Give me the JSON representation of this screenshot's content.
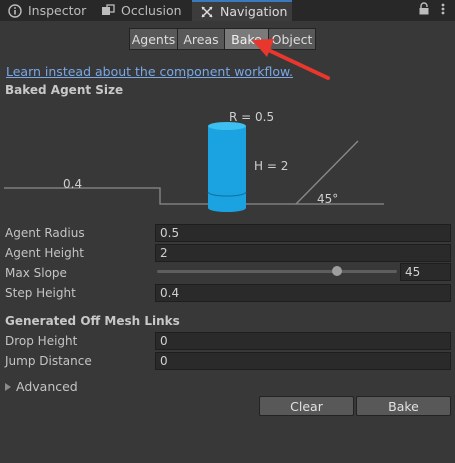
{
  "tabs": [
    {
      "label": "Inspector",
      "icon": "info-icon"
    },
    {
      "label": "Occlusion",
      "icon": "occlusion-icon"
    },
    {
      "label": "Navigation",
      "icon": "navigation-icon",
      "active": true
    }
  ],
  "window_controls": {
    "lock": "lock-icon",
    "menu": "kebab-menu-icon"
  },
  "segments": [
    "Agents",
    "Areas",
    "Bake",
    "Object"
  ],
  "selected_segment": "Bake",
  "link_text": "Learn instead about the component workflow.",
  "baked_agent_size": {
    "header": "Baked Agent Size",
    "radius_label": "R = 0.5",
    "height_label": "H = 2",
    "step_label": "0.4",
    "slope_label": "45°"
  },
  "fields": {
    "agent_radius": {
      "label": "Agent Radius",
      "value": "0.5"
    },
    "agent_height": {
      "label": "Agent Height",
      "value": "2"
    },
    "max_slope": {
      "label": "Max Slope",
      "value": "45",
      "fraction": 0.75
    },
    "step_height": {
      "label": "Step Height",
      "value": "0.4"
    }
  },
  "off_mesh": {
    "header": "Generated Off Mesh Links",
    "drop_height": {
      "label": "Drop Height",
      "value": "0"
    },
    "jump_distance": {
      "label": "Jump Distance",
      "value": "0"
    }
  },
  "advanced_label": "Advanced",
  "buttons": {
    "clear": "Clear",
    "bake": "Bake"
  },
  "colors": {
    "accent_tab": "#3a79bb",
    "cylinder": "#1aa3e0",
    "annotation_arrow": "#e8372c",
    "link": "#7aa7e6"
  }
}
